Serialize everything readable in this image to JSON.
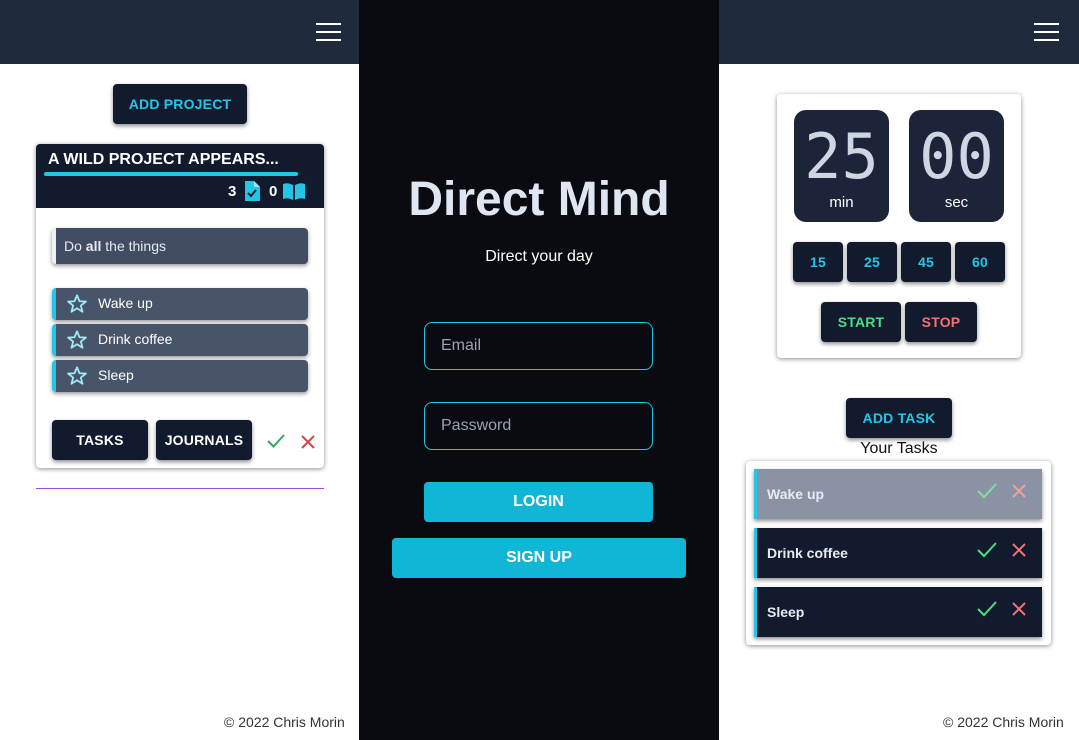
{
  "left": {
    "add_project_label": "ADD PROJECT",
    "project": {
      "title": "A WILD PROJECT APPEARS...",
      "tasks_count": "3",
      "journals_count": "0",
      "note": {
        "prefix": "Do ",
        "bold": "all",
        "suffix": " the things"
      },
      "todos": [
        {
          "label": "Wake up",
          "icon": "star-icon"
        },
        {
          "label": "Drink coffee",
          "icon": "star-icon"
        },
        {
          "label": "Sleep",
          "icon": "star-icon"
        }
      ],
      "tasks_button": "TASKS",
      "journals_button": "JOURNALS"
    },
    "footer": "© 2022  Chris Morin"
  },
  "center": {
    "title": "Direct Mind",
    "tagline": "Direct your day",
    "email_placeholder": "Email",
    "password_placeholder": "Password",
    "login_label": "LOGIN",
    "signup_label": "SIGN UP"
  },
  "right": {
    "timer": {
      "minutes": "25",
      "min_label": "min",
      "seconds": "00",
      "sec_label": "sec",
      "presets": [
        "15",
        "25",
        "45",
        "60"
      ],
      "start_label": "START",
      "stop_label": "STOP"
    },
    "add_task_label": "ADD TASK",
    "tasks_heading": "Your Tasks",
    "tasks": [
      {
        "label": "Wake up",
        "completed": true
      },
      {
        "label": "Drink coffee",
        "completed": false
      },
      {
        "label": "Sleep",
        "completed": false
      }
    ],
    "footer": "© 2022  Chris Morin"
  },
  "colors": {
    "navbar": "#1f2a3c",
    "accent_cyan": "#22c7e8",
    "button_dark": "#121b2e",
    "center_bg": "#090b10",
    "check_green": "#3fbf6b",
    "cross_red": "#e04a4a",
    "start_green": "#4ade80",
    "stop_red": "#f87171"
  }
}
